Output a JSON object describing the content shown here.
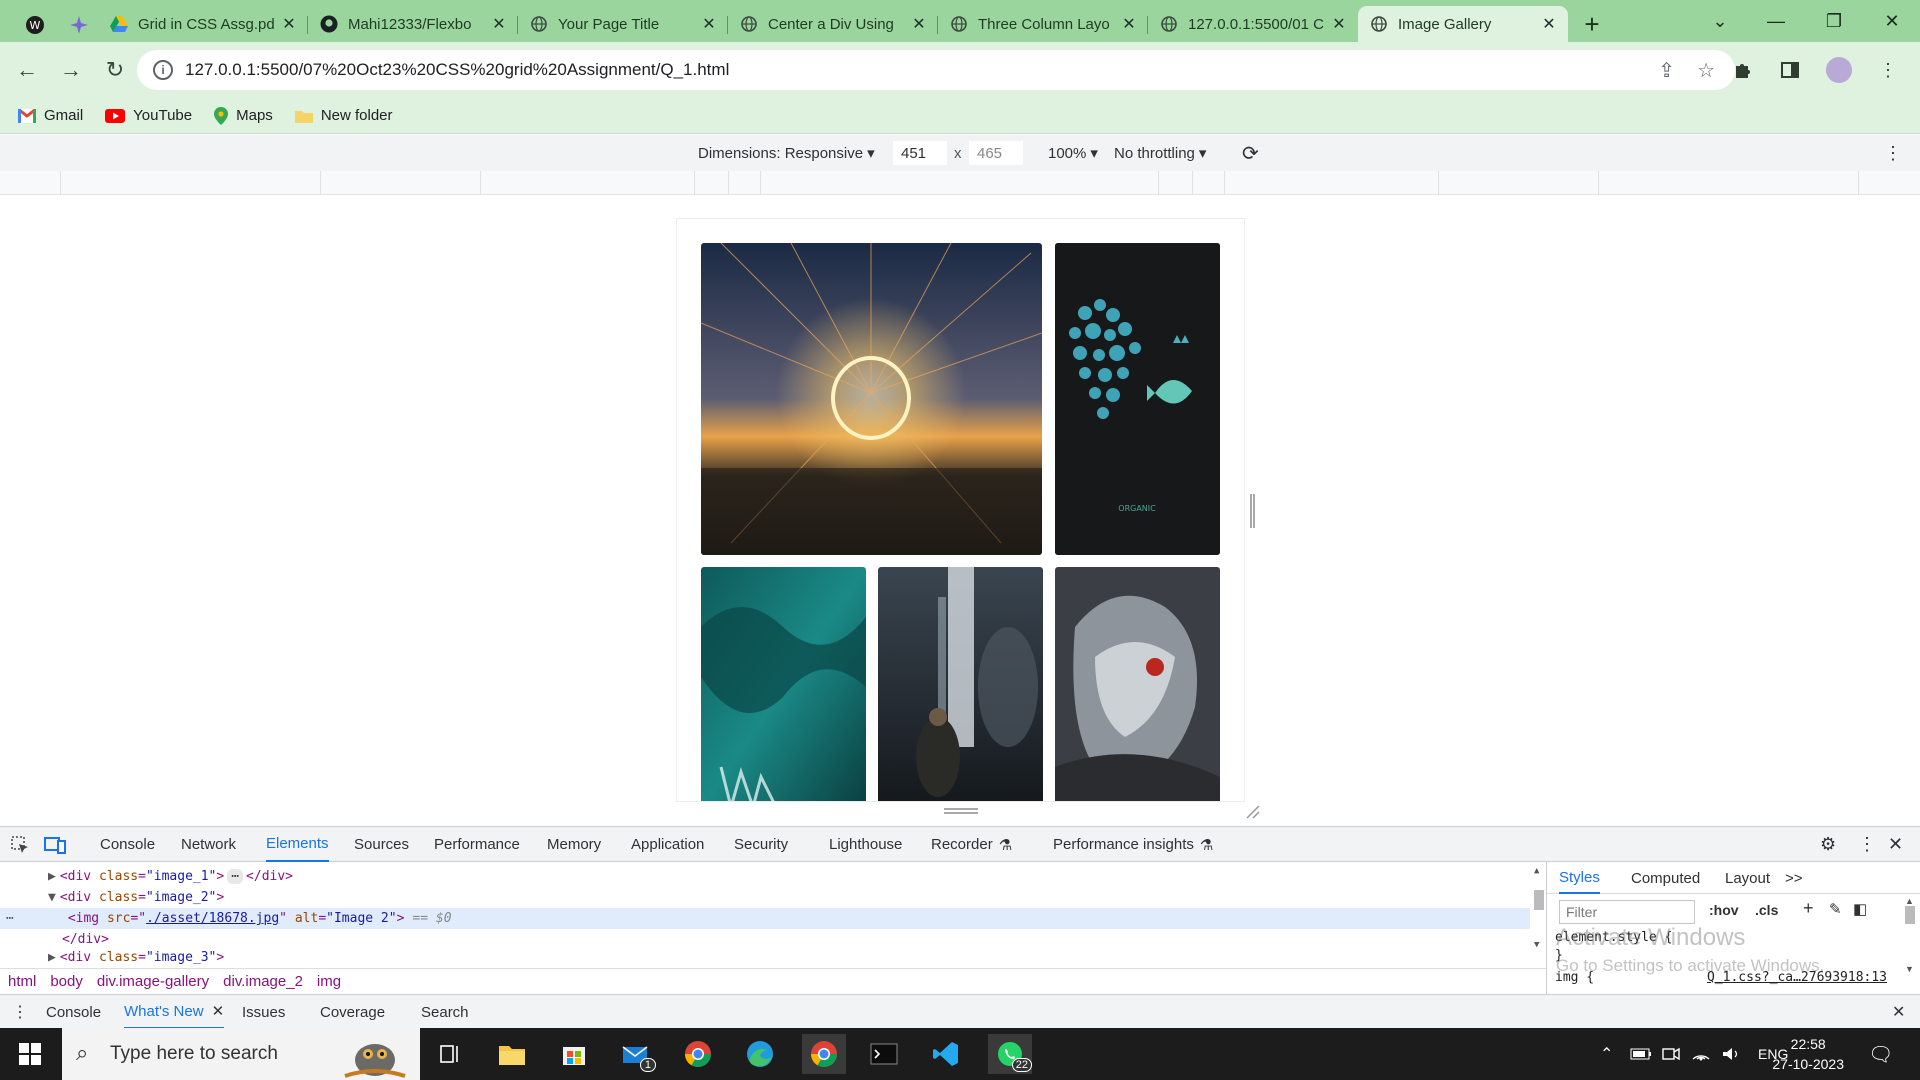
{
  "browser": {
    "tabs": [
      {
        "title": "Grid in CSS Assg.pd",
        "icon": "google-drive-icon"
      },
      {
        "title": "Mahi12333/Flexbo",
        "icon": "github-icon"
      },
      {
        "title": "Your Page Title",
        "icon": "globe-icon"
      },
      {
        "title": "Center a Div Using",
        "icon": "globe-icon"
      },
      {
        "title": "Three Column Layo",
        "icon": "globe-icon"
      },
      {
        "title": "127.0.0.1:5500/01 C",
        "icon": "globe-icon"
      },
      {
        "title": "Image Gallery",
        "icon": "globe-icon",
        "active": true
      }
    ],
    "url": "127.0.0.1:5500/07%20Oct23%20CSS%20grid%20Assignment/Q_1.html",
    "bookmarks": [
      {
        "label": "Gmail",
        "icon": "gmail-icon"
      },
      {
        "label": "YouTube",
        "icon": "youtube-icon"
      },
      {
        "label": "Maps",
        "icon": "maps-icon"
      },
      {
        "label": "New folder",
        "icon": "folder-icon"
      }
    ],
    "colors": {
      "frame": "#9ad59e",
      "toolbar": "#dff1df"
    }
  },
  "device_toolbar": {
    "dimensions_label": "Dimensions: Responsive",
    "width": "451",
    "times": "x",
    "height_placeholder": "465",
    "zoom": "100%",
    "throttling": "No throttling"
  },
  "gallery": {
    "images": [
      {
        "alt": "Image 1",
        "description": "steel wool light painting at sunset"
      },
      {
        "alt": "Image 2",
        "description": "organic fish on dark background",
        "caption": "ORGANIC"
      },
      {
        "alt": "Image 3",
        "description": "teal abstract"
      },
      {
        "alt": "Image 4",
        "description": "waterfall with warrior"
      },
      {
        "alt": "Image 5",
        "description": "armored creature"
      }
    ]
  },
  "devtools": {
    "tabs": [
      "Console",
      "Network",
      "Elements",
      "Sources",
      "Performance",
      "Memory",
      "Application",
      "Security",
      "Lighthouse",
      "Recorder",
      "Performance insights"
    ],
    "active_tab": "Elements",
    "dom_lines": {
      "line1_tag": "div",
      "line1_attr": "class",
      "line1_val": "\"image_1\"",
      "line2_tag": "div",
      "line2_attr": "class",
      "line2_val": "\"image_2\"",
      "line3_tag": "img",
      "line3_src_attr": "src",
      "line3_src": "./asset/18678.jpg",
      "line3_alt_attr": "alt",
      "line3_alt": "\"Image 2\"",
      "line3_eq": "== $0",
      "line4": "</div>",
      "line5_tag": "div",
      "line5_attr": "class",
      "line5_val": "\"image_3\""
    },
    "breadcrumbs": [
      "html",
      "body",
      "div.image-gallery",
      "div.image_2",
      "img"
    ],
    "styles_tabs": [
      "Styles",
      "Computed",
      "Layout",
      ">>"
    ],
    "filter_placeholder": "Filter",
    "hov": ":hov",
    "cls": ".cls",
    "element_style": "element.style {",
    "brace": "}",
    "img_rule": "img {",
    "img_source": "Q_1.css?_ca…27693918:13",
    "drawer_tabs": [
      "Console",
      "What's New",
      "Issues",
      "Coverage",
      "Search"
    ],
    "drawer_active": "What's New"
  },
  "watermark": {
    "title": "Activate Windows",
    "subtitle": "Go to Settings to activate Windows."
  },
  "taskbar": {
    "search_placeholder": "Type here to search",
    "mail_badge": "1",
    "whatsapp_badge": "22",
    "lang": "ENG",
    "time": "22:58",
    "date": "27-10-2023"
  }
}
